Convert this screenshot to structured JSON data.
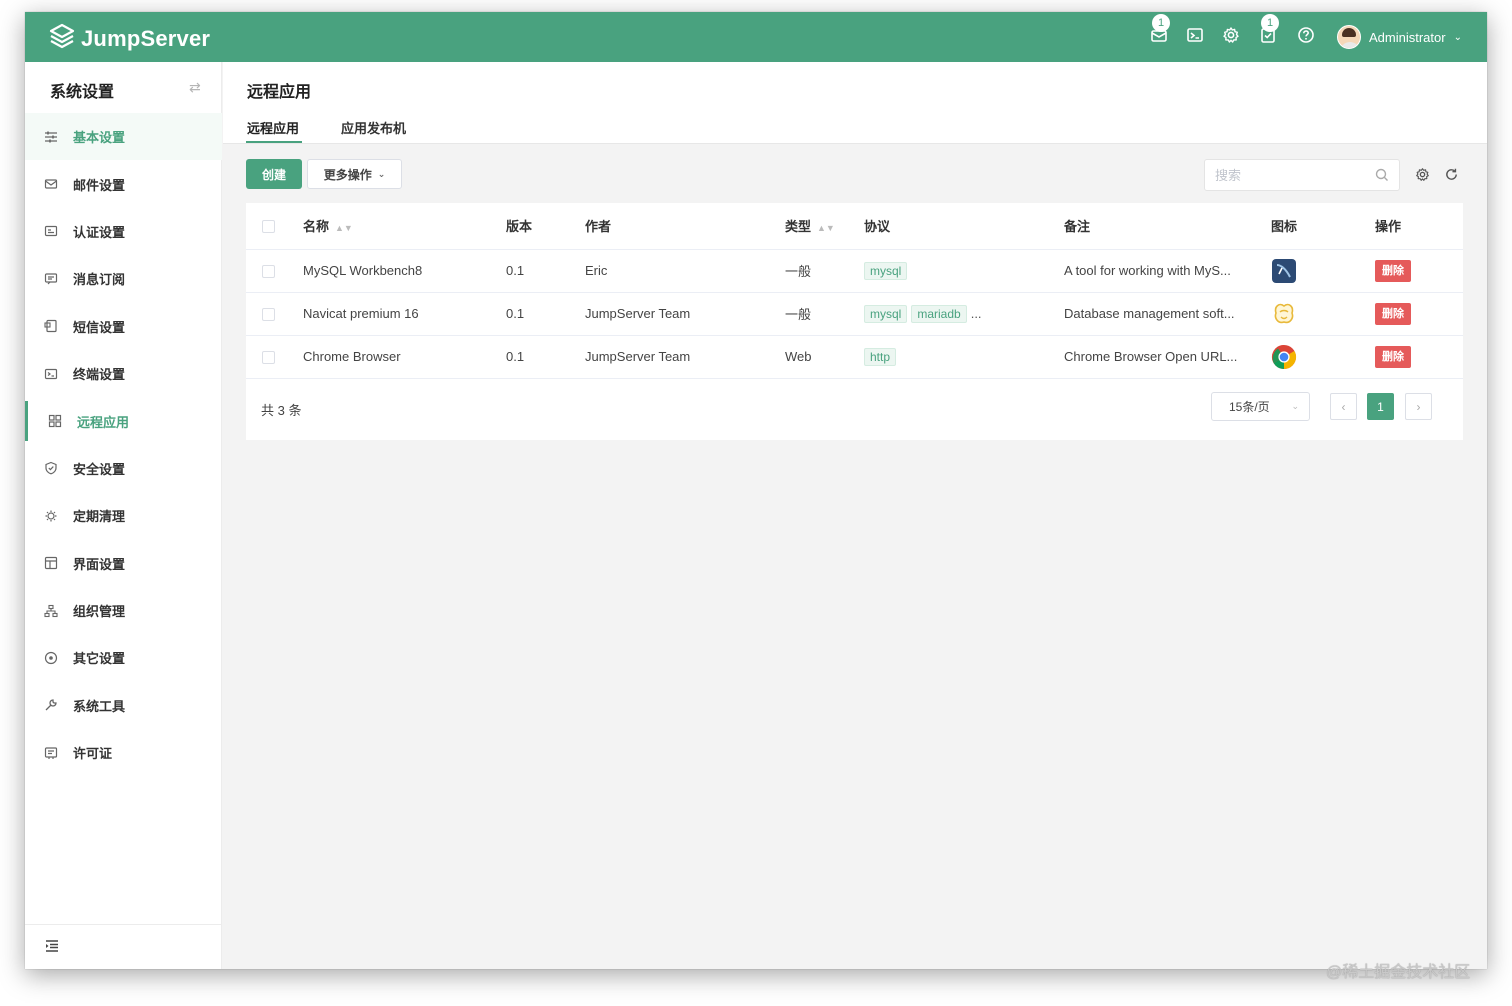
{
  "topbar": {
    "brand": "JumpServer",
    "icons": [
      {
        "name": "message-icon",
        "badge": "1"
      },
      {
        "name": "terminal-icon",
        "badge": ""
      },
      {
        "name": "settings-icon",
        "badge": ""
      },
      {
        "name": "tickets-icon",
        "badge": "1"
      },
      {
        "name": "help-icon",
        "badge": ""
      }
    ],
    "username": "Administrator"
  },
  "sidebar": {
    "title": "系统设置",
    "items": [
      {
        "label": "基本设置",
        "icon": "sliders-icon"
      },
      {
        "label": "邮件设置",
        "icon": "mail-icon"
      },
      {
        "label": "认证设置",
        "icon": "id-card-icon"
      },
      {
        "label": "消息订阅",
        "icon": "message-icon"
      },
      {
        "label": "短信设置",
        "icon": "sms-icon"
      },
      {
        "label": "终端设置",
        "icon": "terminal-icon"
      },
      {
        "label": "远程应用",
        "icon": "apps-icon"
      },
      {
        "label": "安全设置",
        "icon": "shield-icon"
      },
      {
        "label": "定期清理",
        "icon": "clean-icon"
      },
      {
        "label": "界面设置",
        "icon": "layout-icon"
      },
      {
        "label": "组织管理",
        "icon": "org-icon"
      },
      {
        "label": "其它设置",
        "icon": "more-icon"
      },
      {
        "label": "系统工具",
        "icon": "tools-icon"
      },
      {
        "label": "许可证",
        "icon": "license-icon"
      }
    ],
    "active_index": 6
  },
  "main": {
    "title": "远程应用",
    "tabs": [
      {
        "label": "远程应用",
        "active": true
      },
      {
        "label": "应用发布机",
        "active": false
      }
    ],
    "create_label": "创建",
    "more_label": "更多操作",
    "search_placeholder": "搜索"
  },
  "table": {
    "columns": [
      "名称",
      "版本",
      "作者",
      "类型",
      "协议",
      "备注",
      "图标",
      "操作"
    ],
    "rows": [
      {
        "name": "MySQL Workbench8",
        "version": "0.1",
        "author": "Eric",
        "type": "一般",
        "protocols": [
          "mysql"
        ],
        "more": "",
        "comment": "A tool for working with MyS...",
        "icon": "mysql-workbench-icon",
        "action": "删除"
      },
      {
        "name": "Navicat premium 16",
        "version": "0.1",
        "author": "JumpServer Team",
        "type": "一般",
        "protocols": [
          "mysql",
          "mariadb"
        ],
        "more": "...",
        "comment": "Database management soft...",
        "icon": "navicat-icon",
        "action": "删除"
      },
      {
        "name": "Chrome Browser",
        "version": "0.1",
        "author": "JumpServer Team",
        "type": "Web",
        "protocols": [
          "http"
        ],
        "more": "",
        "comment": "Chrome Browser Open URL...",
        "icon": "chrome-icon",
        "action": "删除"
      }
    ],
    "total_text": "共 3 条",
    "page_size": "15条/页",
    "current_page": "1"
  },
  "colors": {
    "accent": "#49a27f",
    "danger": "#e55a5a"
  },
  "watermark": "@稀土掘金技术社区"
}
